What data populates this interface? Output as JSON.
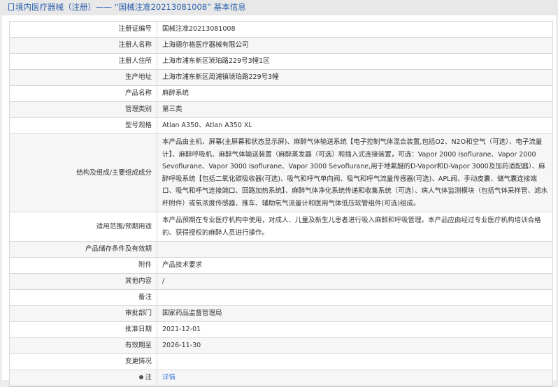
{
  "header": {
    "title": "境内医疗器械（注册）—— “国械注准20213081008” 基本信息"
  },
  "rows": [
    {
      "label": "注册证编号",
      "value": "国械注准20213081008"
    },
    {
      "label": "注册人名称",
      "value": "上海德尔格医疗器械有限公司"
    },
    {
      "label": "注册人住所",
      "value": "上海市浦东新区琥珀路229号3幢1区"
    },
    {
      "label": "生产地址",
      "value": "上海市浦东新区周浦镇琥珀路229号3幢"
    },
    {
      "label": "产品名称",
      "value": "麻醉系统"
    },
    {
      "label": "管理类别",
      "value": "第三类"
    },
    {
      "label": "型号规格",
      "value": "Atlan A350、Atlan A350 XL"
    },
    {
      "label": "结构及组成/主要组成成分",
      "value": "本产品由主机、屏幕(主屏幕和状态显示屏)、麻醉气体输送系统【电子控制气体混合装置,包括O2、N2O和空气（可选）、电子流量计】、麻醉呼吸机、麻醉气体输送装置（麻醉蒸发器（可选）和插入式连接装置，可选：Vapor 2000 Isoflurane、Vapor 2000 Sevoflurane、Vapor 3000 Isoflurane、Vapor 3000 Sevoflurane,用于地氟醚的D-Vapor和D-Vapor 3000及加药适配器）、麻醉呼吸系统【包括二氧化碳吸收器(可选)、吸气和呼气单向阀、吸气和呼气流量传感器(可选)、APL阀、手动皮囊、储气囊连接端口、吸气和呼气连接端口、回路加热系统】、麻醉气体净化系统传递和收集系统（可选）、病人气体监测模块（包括气体采样管、滤水杯附件）或氧浓度传感器、推车、辅助氧气流量计和医用气体低压软管组件(可选)组成。"
    },
    {
      "label": "适用范围/预期用途",
      "value": "本产品预期在专业医疗机构中使用，对成人、儿童及新生儿患者进行吸入麻醉和呼吸管理。本产品应由经过专业医疗机构培训合格的、获得授权的麻醉人员进行操作。"
    },
    {
      "label": "产品储存条件及有效期",
      "value": ""
    },
    {
      "label": "附件",
      "value": "产品技术要求"
    },
    {
      "label": "其他内容",
      "value": "/"
    },
    {
      "label": "备注",
      "value": ""
    },
    {
      "label": "审批部门",
      "value": "国家药品监督管理局"
    },
    {
      "label": "批准日期",
      "value": "2021-12-01"
    },
    {
      "label": "有效期至",
      "value": "2026-11-30"
    },
    {
      "label": "变更情况",
      "value": ""
    }
  ],
  "note": {
    "label": "注",
    "link": "详情"
  }
}
